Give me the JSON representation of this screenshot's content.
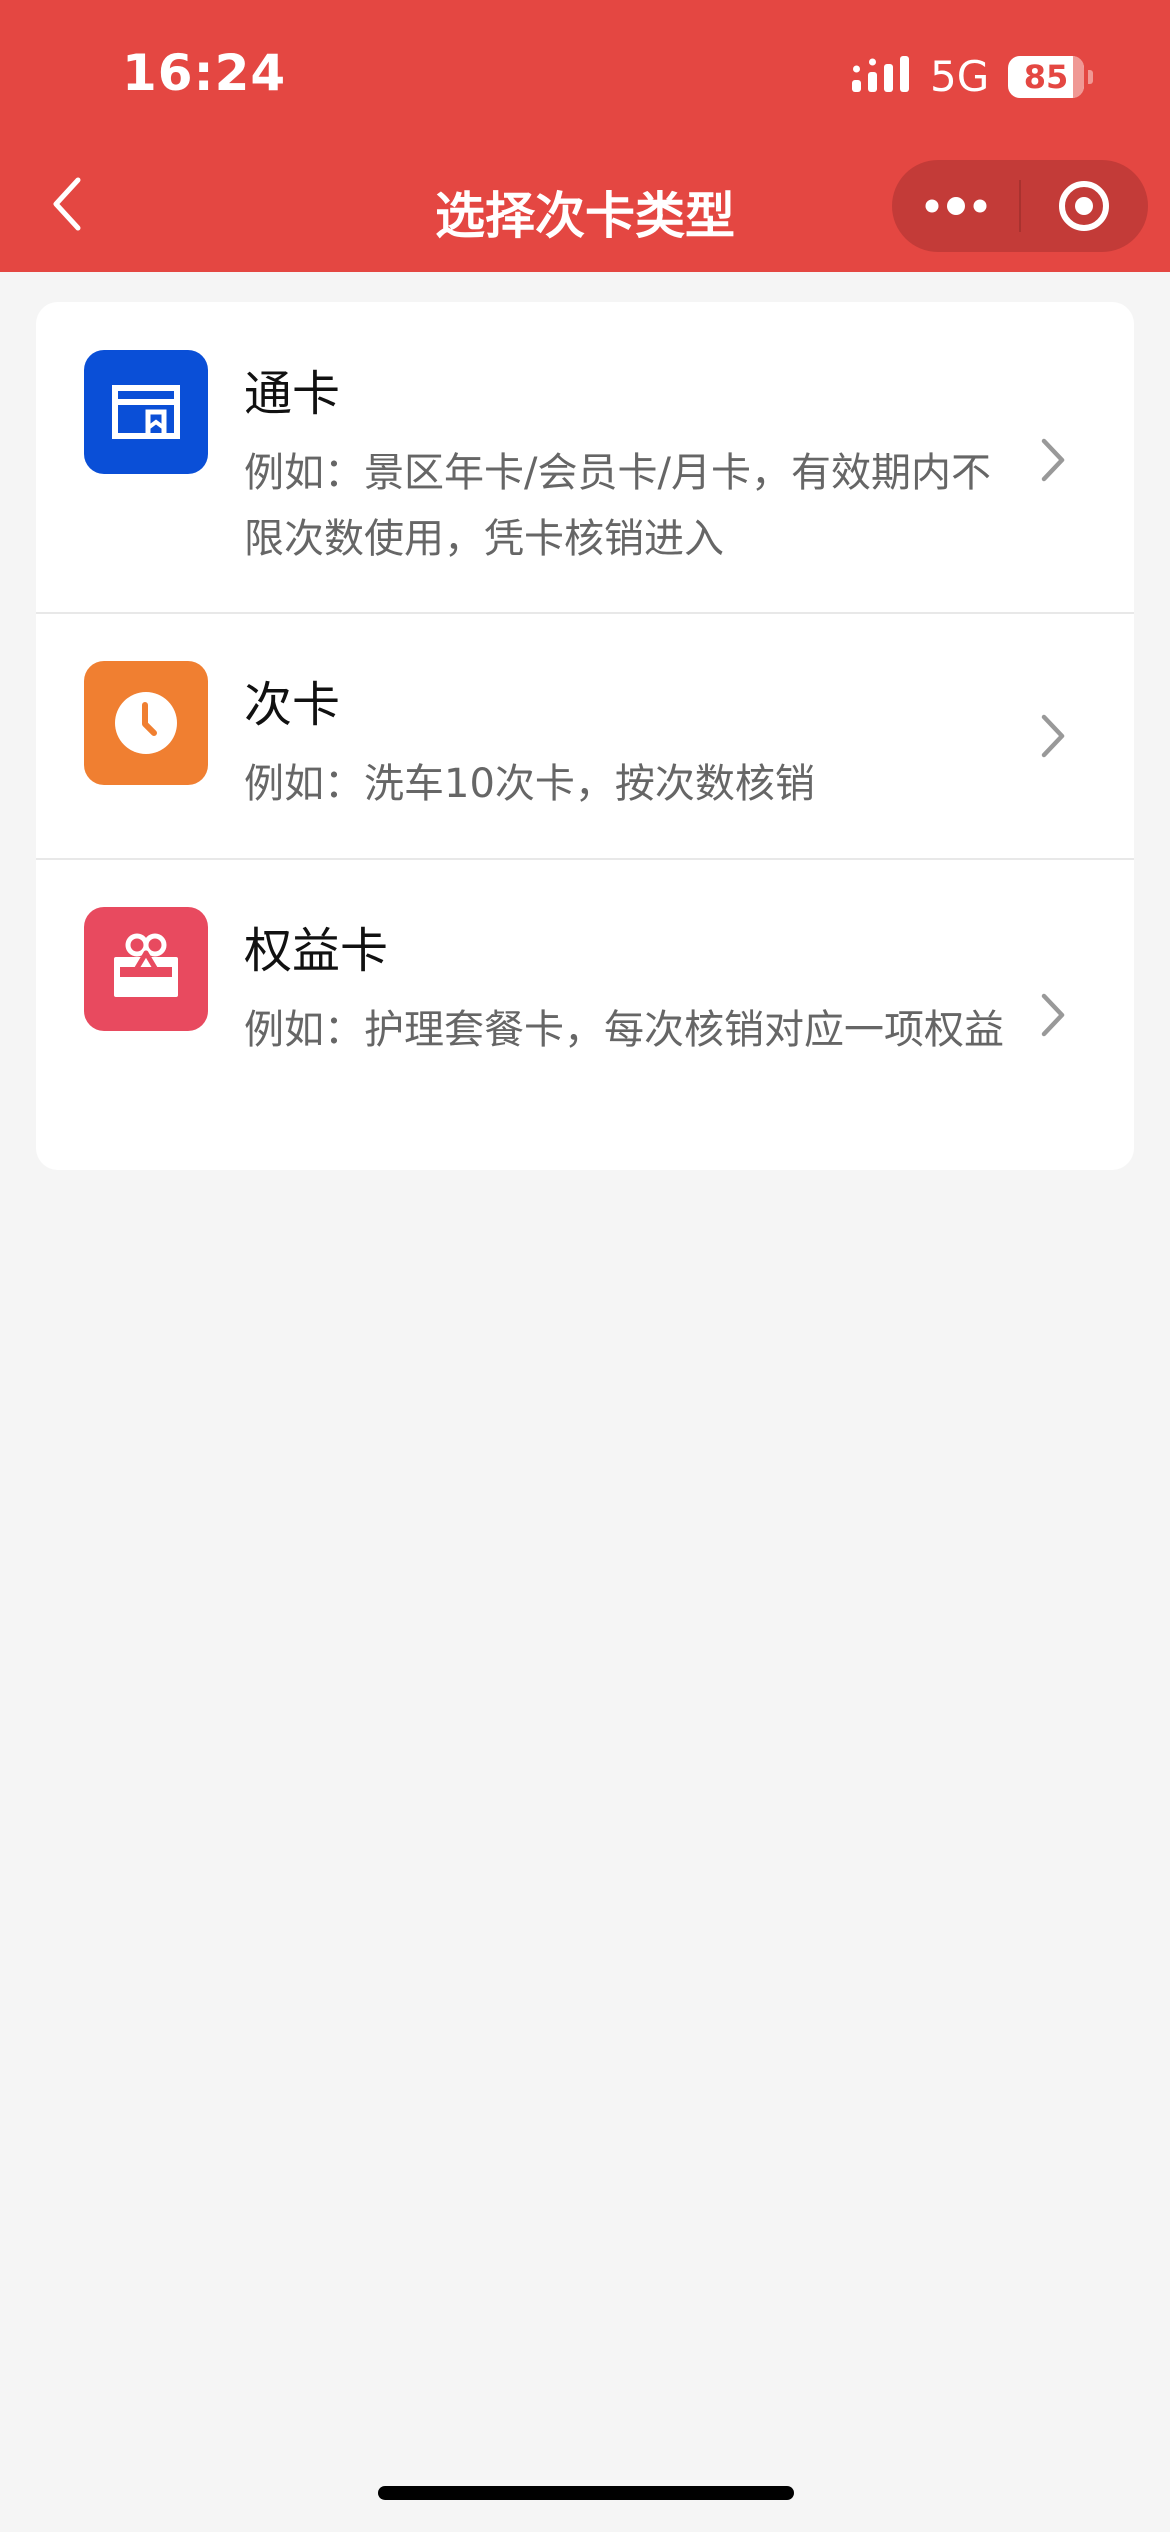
{
  "status_bar": {
    "time": "16:24",
    "network": "5G",
    "battery_level": "85",
    "battery_fraction": 0.85
  },
  "nav": {
    "title": "选择次卡类型",
    "back_icon": "chevron-left-icon",
    "more_icon": "more-dots-icon",
    "close_icon": "target-circle-icon"
  },
  "card_types": [
    {
      "title": "通卡",
      "description": "例如：景区年卡/会员卡/月卡，有效期内不限次数使用，凭卡核销进入",
      "icon": "card-icon",
      "icon_color": "#0a4fd7"
    },
    {
      "title": "次卡",
      "description": "例如：洗车10次卡，按次数核销",
      "icon": "clock-icon",
      "icon_color": "#f07f31"
    },
    {
      "title": "权益卡",
      "description": "例如：护理套餐卡，每次核销对应一项权益",
      "icon": "gift-icon",
      "icon_color": "#e84a5f"
    }
  ],
  "colors": {
    "header_bg": "#e44742",
    "page_bg": "#f5f5f5"
  }
}
